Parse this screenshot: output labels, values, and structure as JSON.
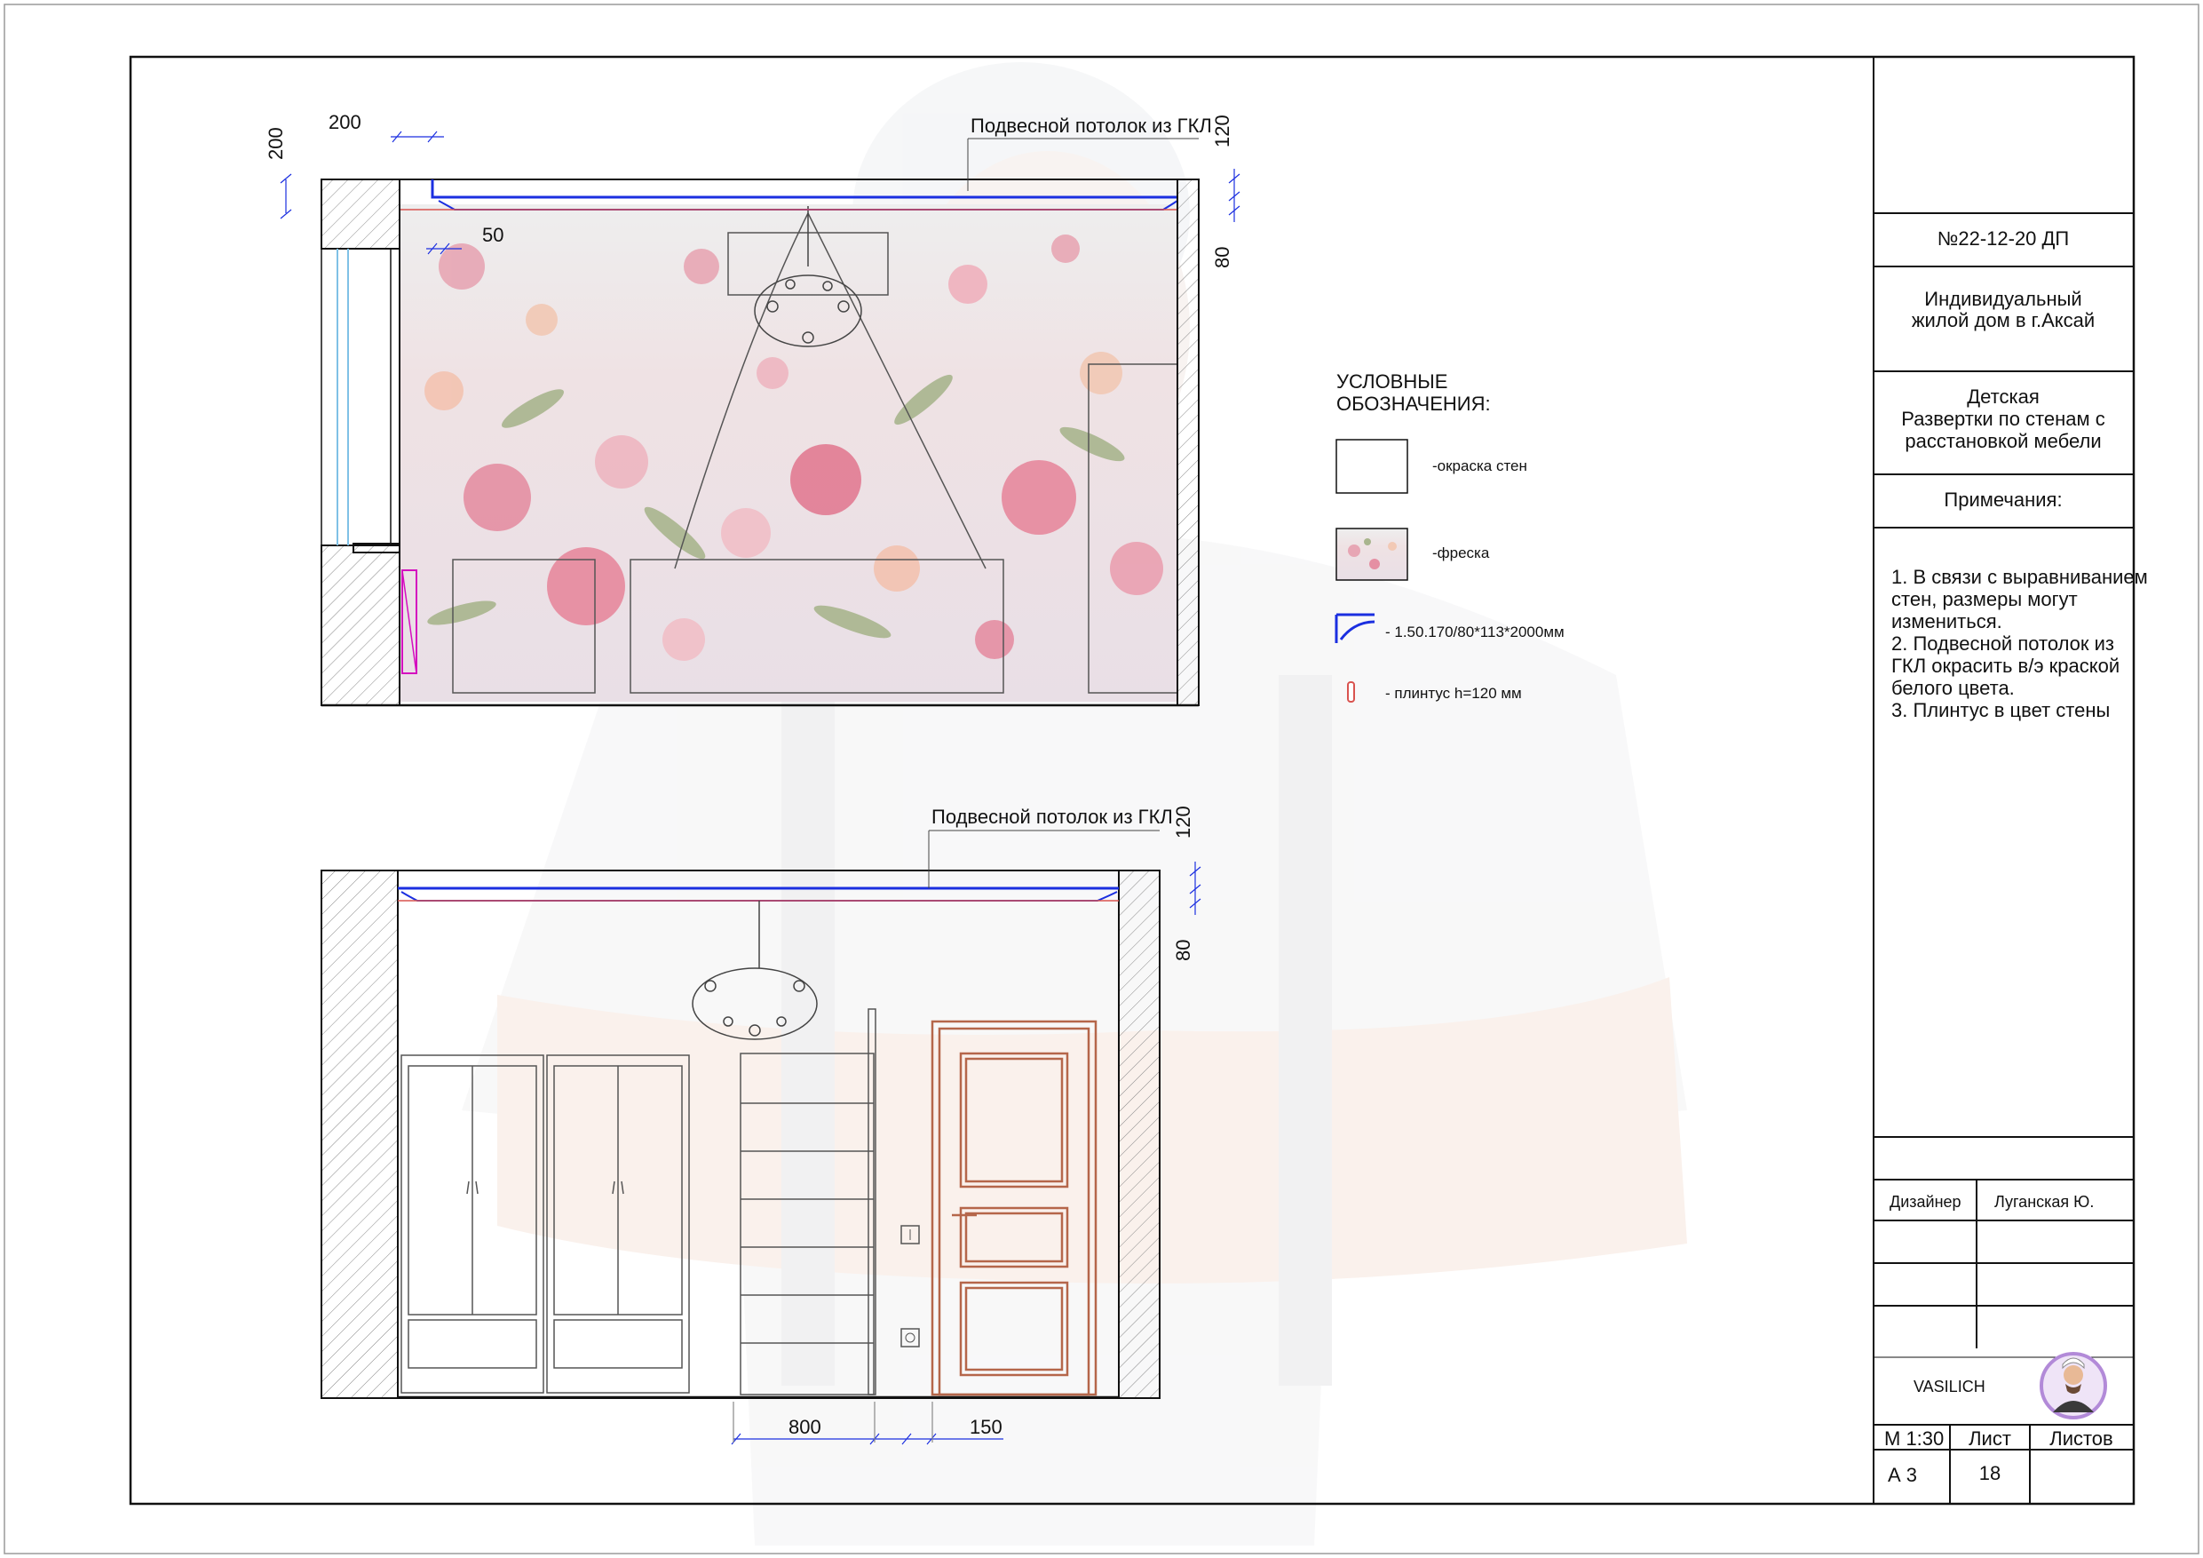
{
  "elevation_top": {
    "dims": {
      "d200_h": "200",
      "d200_v": "200",
      "d50": "50",
      "d120": "120",
      "d80": "80"
    },
    "ceiling_label": "Подвесной потолок из ГКЛ"
  },
  "elevation_bottom": {
    "dims": {
      "d120": "120",
      "d80": "80",
      "d800": "800",
      "d150": "150"
    },
    "ceiling_label": "Подвесной потолок из ГКЛ"
  },
  "legend": {
    "title_line1": "УСЛОВНЫЕ",
    "title_line2": "ОБОЗНАЧЕНИЯ:",
    "items": [
      {
        "label": "-окраска стен"
      },
      {
        "label": "-фреска"
      },
      {
        "label": "- 1.50.170/80*113*2000мм"
      },
      {
        "label": "- плинтус h=120 мм"
      }
    ]
  },
  "title_block": {
    "project_no": "№22-12-20 ДП",
    "object_line1": "Индивидуальный",
    "object_line2": "жилой дом в  г.Аксай",
    "sheet_title_line1": "Детская",
    "sheet_title_line2": "Развертки по стенам с",
    "sheet_title_line3": "расстановкой мебели",
    "notes_header": "Примечания:",
    "notes": [
      "1. В связи с выравниванием",
      "стен, размеры могут",
      "измениться.",
      "2. Подвесной потолок из",
      "ГКЛ окрасить в/э краской",
      "белого цвета.",
      "3. Плинтус в цвет стены"
    ],
    "designer_role": "Дизайнер",
    "designer_name": "Луганская Ю.",
    "brand": "VASILICH",
    "scale_label": "М 1:30",
    "sheet_label": "Лист",
    "sheets_label": "Листов",
    "format": "А 3",
    "sheet_no": "18"
  },
  "colors": {
    "cornice": "#1b2fe0",
    "plinth": "#d9534f",
    "door": "#b5664a",
    "fresco_pink": "#e7a6b4",
    "fresco_green": "#a9b58e"
  }
}
